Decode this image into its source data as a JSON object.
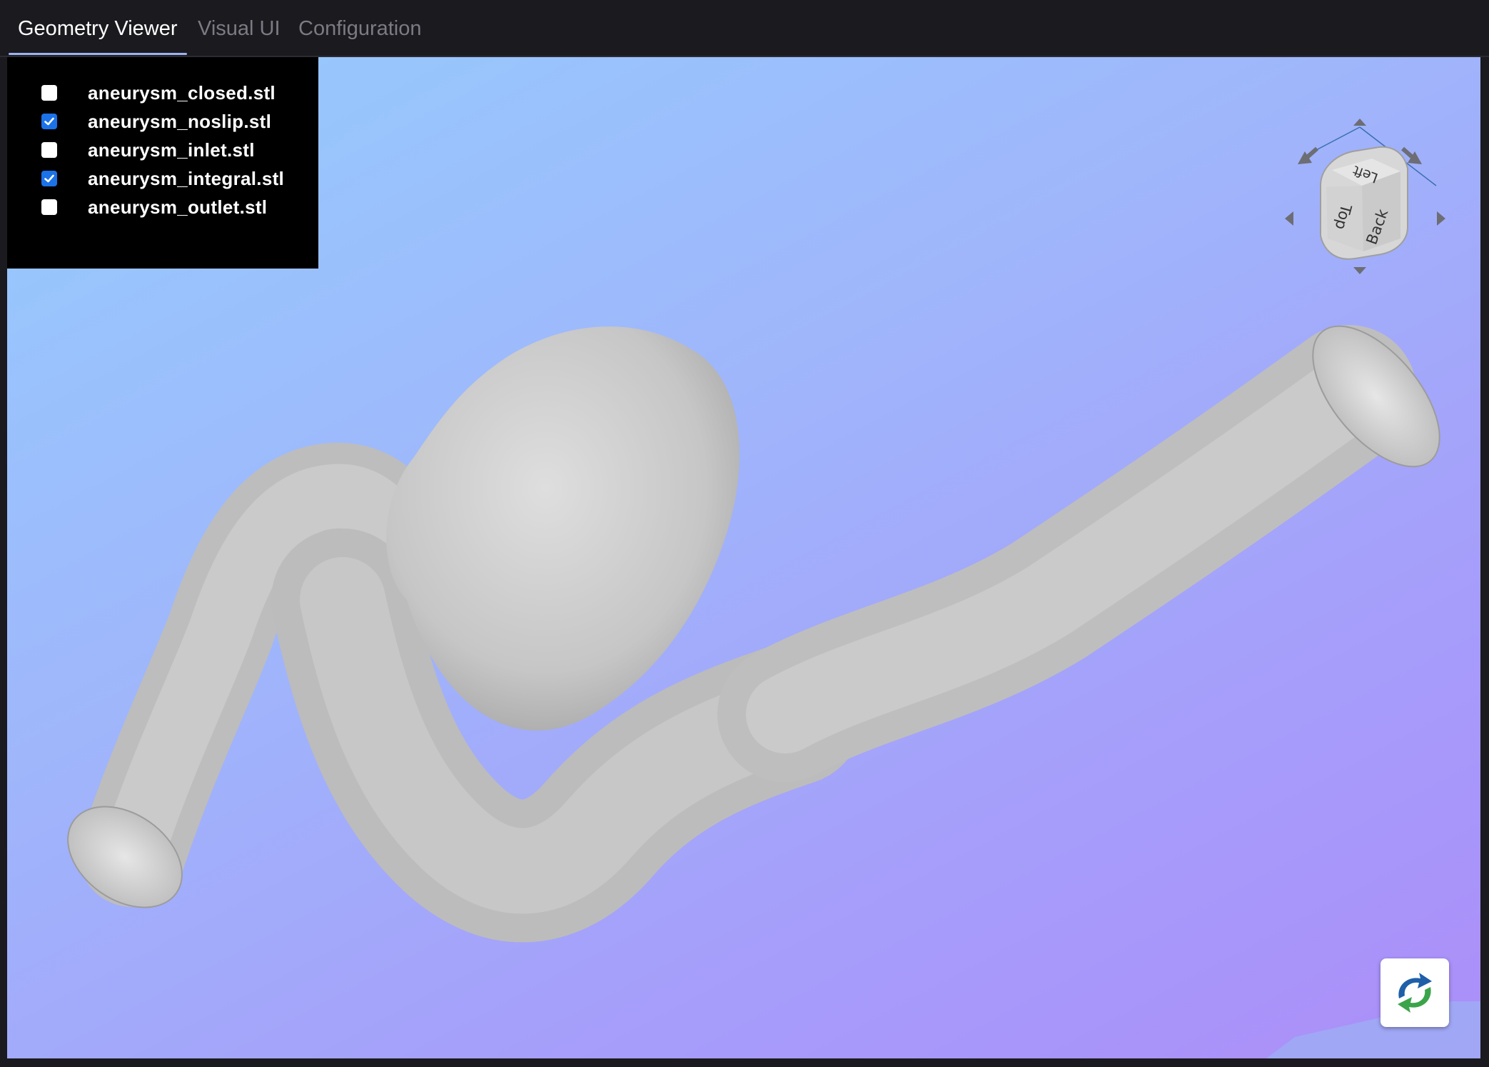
{
  "tabs": [
    {
      "label": "Geometry Viewer",
      "active": true
    },
    {
      "label": "Visual UI",
      "active": false
    },
    {
      "label": "Configuration",
      "active": false
    }
  ],
  "files": [
    {
      "label": "aneurysm_closed.stl",
      "checked": false
    },
    {
      "label": "aneurysm_noslip.stl",
      "checked": true
    },
    {
      "label": "aneurysm_inlet.stl",
      "checked": false
    },
    {
      "label": "aneurysm_integral.stl",
      "checked": true
    },
    {
      "label": "aneurysm_outlet.stl",
      "checked": false
    }
  ],
  "orientation_cube": {
    "faces": {
      "top": "Top",
      "left": "Left",
      "back": "Back"
    }
  },
  "reset_button": {
    "icon": "reset-view-icon"
  },
  "colors": {
    "accent": "#1c72e8",
    "tab_active": "#ffffff",
    "tab_inactive": "#7c7a83",
    "background_top": "#95ccfd",
    "background_bottom": "#ab8ef9",
    "mesh": "#c4c4c4"
  }
}
